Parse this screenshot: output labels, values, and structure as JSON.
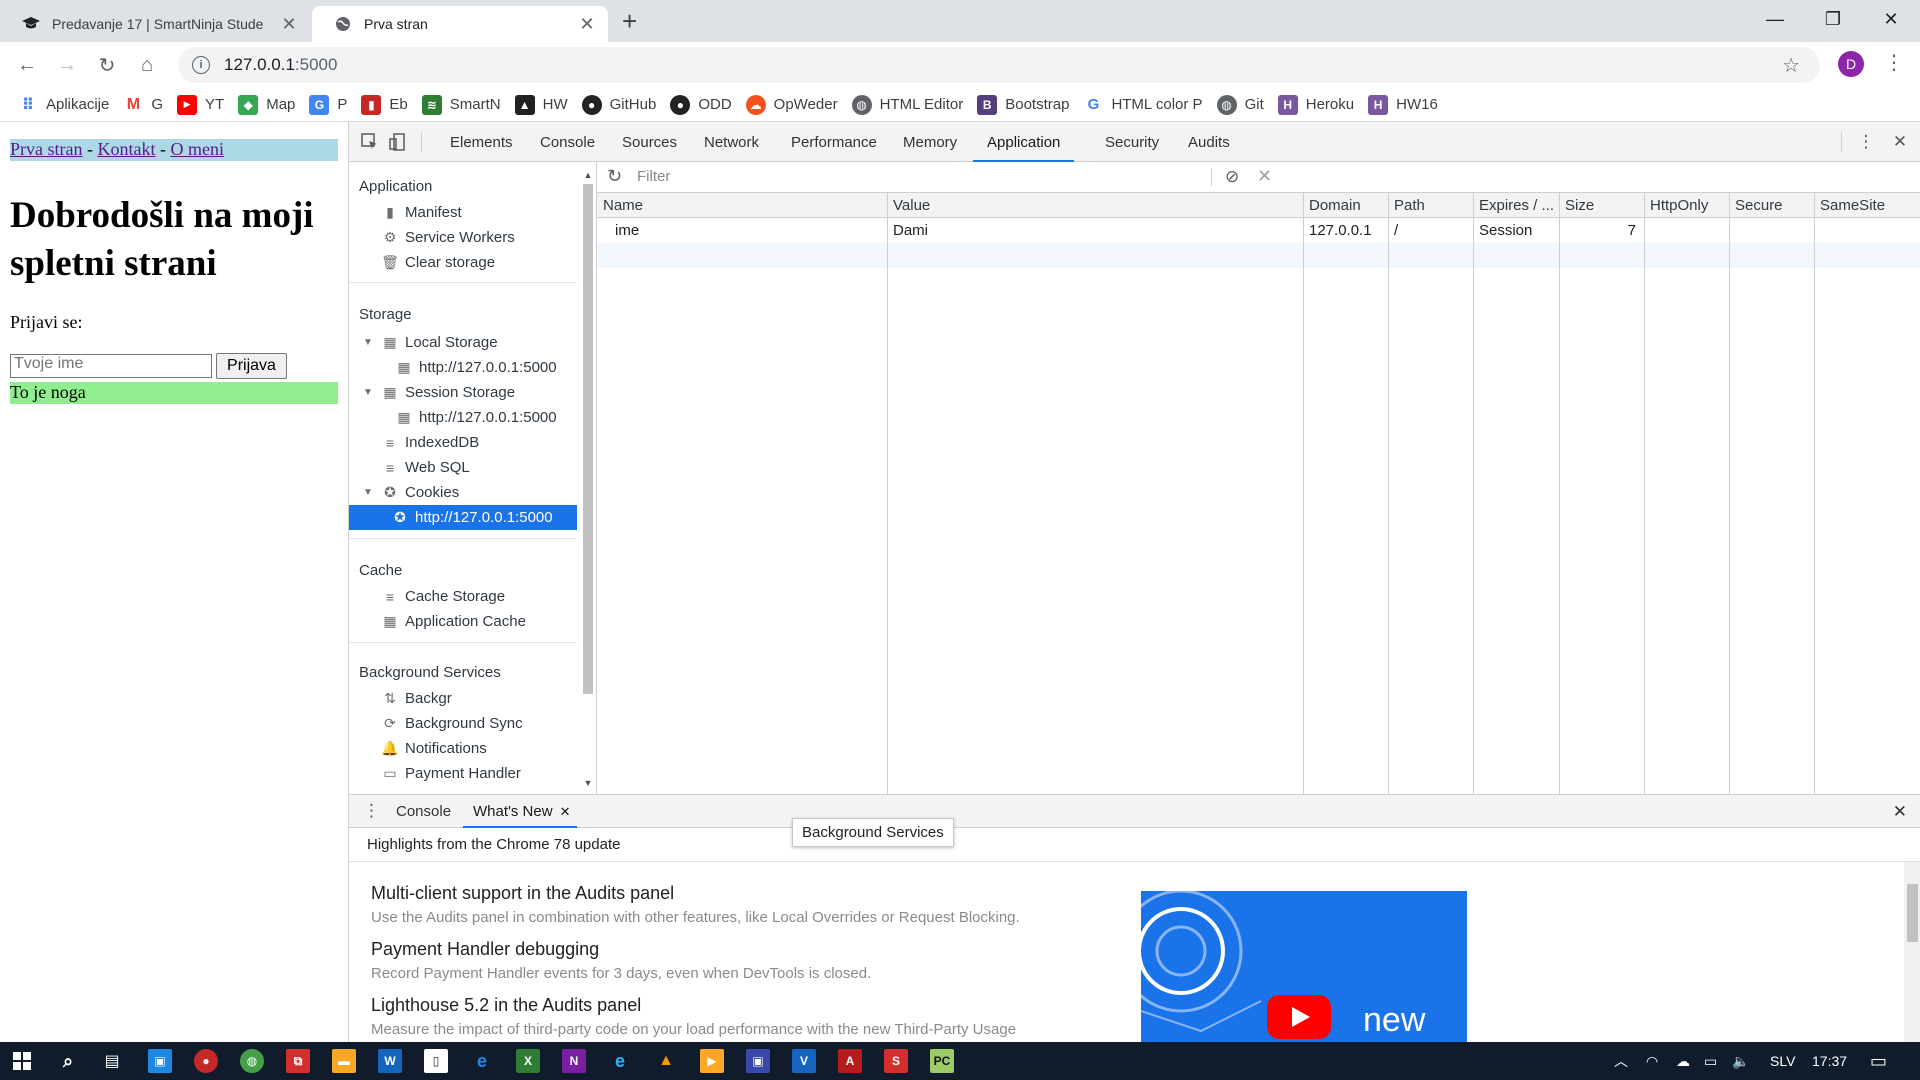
{
  "browser": {
    "tabs": [
      {
        "title": "Predavanje 17 | SmartNinja Stude",
        "active": false,
        "icon": "graduation-cap-icon"
      },
      {
        "title": "Prva stran",
        "active": true,
        "icon": "globe-icon"
      }
    ],
    "url_host": "127.0.0.1",
    "url_port": ":5000",
    "avatar_letter": "D",
    "bookmarks": [
      {
        "label": "Aplikacije",
        "icon": "apps-grid-icon",
        "color": "#4285f4"
      },
      {
        "label": "G",
        "icon": "gmail-icon",
        "color": "#ea4335"
      },
      {
        "label": "YT",
        "icon": "youtube-icon",
        "color": "#ff0000"
      },
      {
        "label": "Map",
        "icon": "maps-icon",
        "color": "#34a853"
      },
      {
        "label": "P",
        "icon": "translate-icon",
        "color": "#4285f4"
      },
      {
        "label": "Eb",
        "icon": "eb-icon",
        "color": "#c62828"
      },
      {
        "label": "SmartN",
        "icon": "smartninja-icon",
        "color": "#2e7d32"
      },
      {
        "label": "HW",
        "icon": "graduation-cap-icon",
        "color": "#222222"
      },
      {
        "label": "GitHub",
        "icon": "github-icon",
        "color": "#222222"
      },
      {
        "label": "ODD",
        "icon": "github-icon",
        "color": "#222222"
      },
      {
        "label": "OpWeder",
        "icon": "opweder-icon",
        "color": "#f4511e"
      },
      {
        "label": "HTML Editor",
        "icon": "globe-icon",
        "color": "#5f6368"
      },
      {
        "label": "Bootstrap",
        "icon": "bootstrap-icon",
        "color": "#563d7c"
      },
      {
        "label": "HTML color P",
        "icon": "google-icon",
        "color": "#4285f4"
      },
      {
        "label": "Git",
        "icon": "globe-icon",
        "color": "#5f6368"
      },
      {
        "label": "Heroku",
        "icon": "heroku-icon",
        "color": "#79589f"
      },
      {
        "label": "HW16",
        "icon": "heroku-icon",
        "color": "#79589f"
      }
    ]
  },
  "page": {
    "nav_links": [
      "Prva stran",
      "Kontakt",
      "O meni"
    ],
    "nav_separator": " - ",
    "heading": "Dobrodošli na moji spletni strani",
    "login_prompt": "Prijavi se:",
    "name_placeholder": "Tvoje ime",
    "submit_label": "Prijava",
    "footer": "To je noga"
  },
  "devtools": {
    "tabs": [
      "Elements",
      "Console",
      "Sources",
      "Network",
      "Performance",
      "Memory",
      "Application",
      "Security",
      "Audits"
    ],
    "selected_tab": "Application",
    "sidebar": {
      "application_heading": "Application",
      "application_items": [
        "Manifest",
        "Service Workers",
        "Clear storage"
      ],
      "storage_heading": "Storage",
      "local_storage": "Local Storage",
      "local_storage_origin": "http://127.0.0.1:5000",
      "session_storage": "Session Storage",
      "session_storage_origin": "http://127.0.0.1:5000",
      "indexeddb": "IndexedDB",
      "websql": "Web SQL",
      "cookies": "Cookies",
      "cookies_origin": "http://127.0.0.1:5000",
      "cache_heading": "Cache",
      "cache_items": [
        "Cache Storage",
        "Application Cache"
      ],
      "bg_heading": "Background Services",
      "bg_items": [
        "Backgr",
        "Background Sync",
        "Notifications",
        "Payment Handler"
      ]
    },
    "tooltip": "Background Services",
    "filter_placeholder": "Filter",
    "cookie_columns": [
      "Name",
      "Value",
      "Domain",
      "Path",
      "Expires / ...",
      "Size",
      "HttpOnly",
      "Secure",
      "SameSite"
    ],
    "cookie_rows": [
      {
        "name": "ime",
        "value": "Dami",
        "domain": "127.0.0.1",
        "path": "/",
        "expires": "Session",
        "size": "7",
        "httponly": "",
        "secure": "",
        "samesite": ""
      }
    ],
    "drawer": {
      "tabs": [
        "Console",
        "What's New"
      ],
      "selected": "What's New",
      "highlights": "Highlights from the Chrome 78 update",
      "news": [
        {
          "title": "Multi-client support in the Audits panel",
          "desc": "Use the Audits panel in combination with other features, like Local Overrides or Request Blocking."
        },
        {
          "title": "Payment Handler debugging",
          "desc": "Record Payment Handler events for 3 days, even when DevTools is closed."
        },
        {
          "title": "Lighthouse 5.2 in the Audits panel",
          "desc": "Measure the impact of third-party code on your load performance with the new Third-Party Usage"
        }
      ],
      "video_text": "new"
    }
  },
  "taskbar": {
    "language": "SLV",
    "time": "17:37"
  },
  "colors": {
    "accent": "#1a73e8",
    "nav_bg": "#add8e6",
    "footer_bg": "#90ee90",
    "taskbar_bg": "#101c2b"
  }
}
